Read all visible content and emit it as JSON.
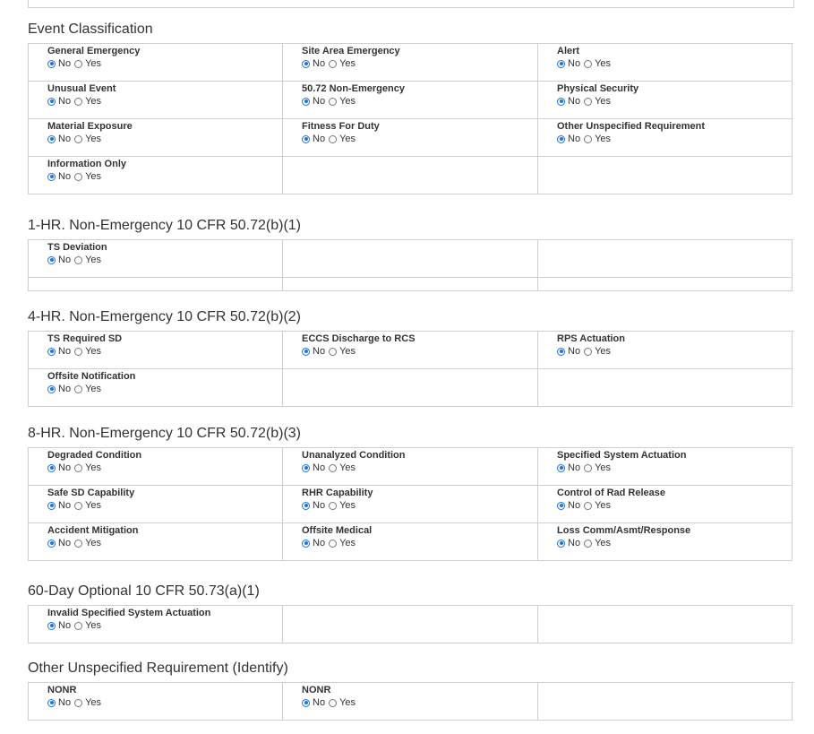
{
  "sections": [
    {
      "title": "Event Classification",
      "rows": [
        [
          {
            "label": "General Emergency"
          },
          {
            "label": "Site Area Emergency"
          },
          {
            "label": "Alert"
          }
        ],
        [
          {
            "label": "Unusual Event"
          },
          {
            "label": "50.72 Non-Emergency"
          },
          {
            "label": "Physical Security"
          }
        ],
        [
          {
            "label": "Material Exposure"
          },
          {
            "label": "Fitness For Duty"
          },
          {
            "label": "Other Unspecified Requirement"
          }
        ],
        [
          {
            "label": "Information Only"
          },
          null,
          null
        ]
      ]
    },
    {
      "title": "1-HR. Non-Emergency 10 CFR 50.72(b)(1)",
      "rows": [
        [
          {
            "label": "TS Deviation"
          },
          null,
          null
        ]
      ],
      "extra_thin_row": true
    },
    {
      "title": "4-HR. Non-Emergency 10 CFR 50.72(b)(2)",
      "rows": [
        [
          {
            "label": "TS Required SD"
          },
          {
            "label": "ECCS Discharge to RCS"
          },
          {
            "label": "RPS Actuation"
          }
        ],
        [
          {
            "label": "Offsite Notification"
          },
          null,
          null
        ]
      ]
    },
    {
      "title": "8-HR. Non-Emergency 10 CFR 50.72(b)(3)",
      "rows": [
        [
          {
            "label": "Degraded Condition"
          },
          {
            "label": "Unanalyzed Condition"
          },
          {
            "label": "Specified System Actuation"
          }
        ],
        [
          {
            "label": "Safe SD Capability"
          },
          {
            "label": "RHR Capability"
          },
          {
            "label": "Control of Rad Release"
          }
        ],
        [
          {
            "label": "Accident Mitigation"
          },
          {
            "label": "Offsite Medical"
          },
          {
            "label": "Loss Comm/Asmt/Response"
          }
        ]
      ]
    },
    {
      "title": "60-Day Optional 10 CFR 50.73(a)(1)",
      "rows": [
        [
          {
            "label": "Invalid Specified System Actuation"
          },
          null,
          null
        ]
      ]
    },
    {
      "title": "Other Unspecified Requirement (Identify)",
      "rows": [
        [
          {
            "label": "NONR"
          },
          {
            "label": "NONR"
          },
          null
        ]
      ]
    }
  ],
  "options": {
    "no": "No",
    "yes": "Yes",
    "selected": "no"
  },
  "colors": {
    "accent": "#1a73e8",
    "border": "#cfcfcf"
  }
}
